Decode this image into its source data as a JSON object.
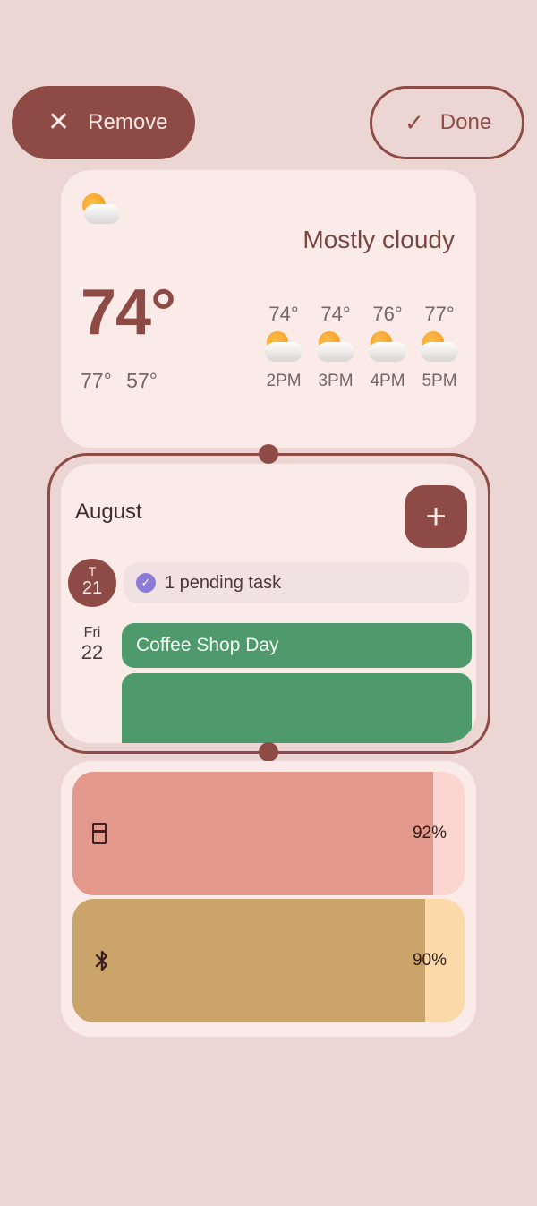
{
  "toolbar": {
    "remove_label": "Remove",
    "done_label": "Done"
  },
  "weather": {
    "condition": "Mostly cloudy",
    "current_temp": "74°",
    "high": "77°",
    "low": "57°",
    "icon": "partly-cloudy-icon",
    "hourly": [
      {
        "temp": "74°",
        "time": "2PM",
        "icon": "partly-cloudy-icon"
      },
      {
        "temp": "74°",
        "time": "3PM",
        "icon": "partly-cloudy-icon"
      },
      {
        "temp": "76°",
        "time": "4PM",
        "icon": "partly-cloudy-icon"
      },
      {
        "temp": "77°",
        "time": "5PM",
        "icon": "partly-cloudy-icon"
      }
    ]
  },
  "calendar": {
    "month": "August",
    "add_icon": "+",
    "today": {
      "weekday": "T",
      "day": "21"
    },
    "task_chip": "1 pending task",
    "next_day": {
      "weekday": "Fri",
      "day": "22"
    },
    "event_title": "Coffee Shop Day"
  },
  "battery": {
    "items": [
      {
        "device": "case",
        "icon": "battery-case-icon",
        "percent": "92%",
        "level": 0.92,
        "color": "#e3988c",
        "track": "#fbd6d1"
      },
      {
        "device": "bluetooth",
        "icon": "bluetooth-icon",
        "percent": "90%",
        "level": 0.9,
        "color": "#cba46b",
        "track": "#fbd9a9"
      }
    ]
  },
  "colors": {
    "background": "#ecd6d3",
    "accent": "#8e4a45",
    "card": "#fbebe8",
    "event": "#4f9a6c"
  }
}
